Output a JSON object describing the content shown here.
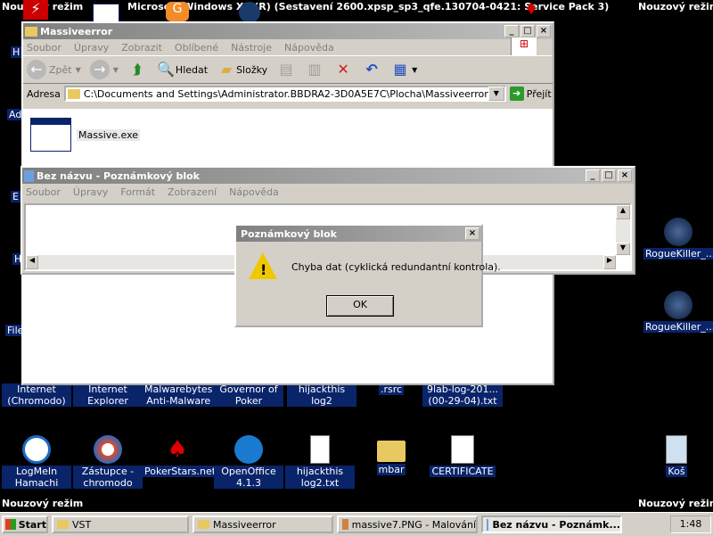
{
  "overlays": {
    "top_left": "Nouzový režim",
    "top_center": "Microsoft Windows XP (R) (Sestavení 2600.xpsp_sp3_qfe.130704-0421: Service Pack 3)",
    "top_right": "Nouzový režim",
    "bottom_left": "Nouzový režim",
    "bottom_right": "Nouzový režim"
  },
  "desktop_icons": {
    "internet_chromodo": "Internet (Chromodo)",
    "internet_explorer": "Internet Explorer",
    "malwarebytes": "Malwarebytes Anti-Malware",
    "governor_of_poker": "Governor of Poker",
    "hijackthis_log2": "hijackthis log2",
    "rsrc": ".rsrc",
    "9lab_log": "9lab-log-201... (00-29-04).txt",
    "logmein": "LogMeIn Hamachi",
    "zastupce_chromodo": "Zástupce - chromodo",
    "pokerstars": "PokerStars.net",
    "openoffice": "OpenOffice 4.1.3",
    "hijackthis_log2_txt": "hijackthis log2.txt",
    "mbar": "mbar",
    "certificate": "CERTIFICATE",
    "kos": "Koš",
    "roguekiller_1": "RogueKiller_...",
    "roguekiller_2": "RogueKiller_...",
    "left_partial": [
      "H",
      "Ad",
      "E",
      "H",
      "File"
    ]
  },
  "explorer": {
    "title": "Massiveerror",
    "menu": [
      "Soubor",
      "Úpravy",
      "Zobrazit",
      "Oblíbené",
      "Nástroje",
      "Nápověda"
    ],
    "toolbar": {
      "back": "Zpět",
      "search": "Hledat",
      "folders": "Složky"
    },
    "address_label": "Adresa",
    "address_value": "C:\\Documents and Settings\\Administrator.BBDRA2-3D0A5E7C\\Plocha\\Massiveerror",
    "go_label": "Přejít",
    "file_name": "Massive.exe"
  },
  "notepad": {
    "title": "Bez názvu - Poznámkový blok",
    "menu": [
      "Soubor",
      "Úpravy",
      "Formát",
      "Zobrazení",
      "Nápověda"
    ]
  },
  "dialog": {
    "title": "Poznámkový blok",
    "message": "Chyba dat (cyklická redundantní kontrola).",
    "ok_label": "OK"
  },
  "taskbar": {
    "start_label": "Start",
    "tasks": [
      "VST",
      "Massiveerror",
      "massive7.PNG - Malování",
      "Bez názvu - Poznámk..."
    ],
    "clock": "1:48"
  }
}
